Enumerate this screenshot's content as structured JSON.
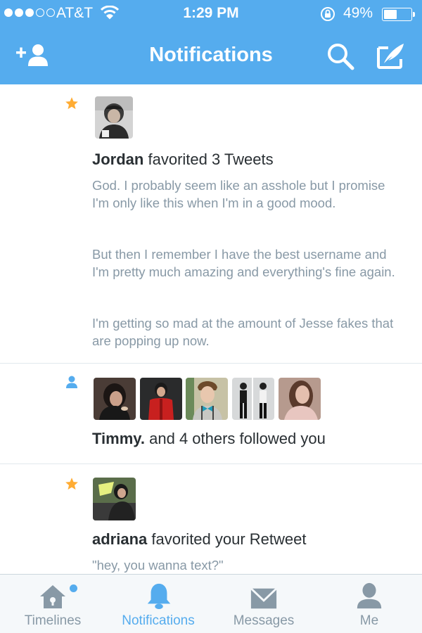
{
  "status": {
    "carrier": "AT&T",
    "time": "1:29 PM",
    "battery": "49%",
    "battery_level": 0.49
  },
  "nav": {
    "title": "Notifications"
  },
  "notifications": [
    {
      "type": "favorite",
      "user": "Jordan",
      "action": "favorited 3 Tweets",
      "tweets": [
        "God. I probably seem like an asshole but I promise I'm only like this when I'm in a good mood.",
        "But then I remember I have the best username and I'm pretty much amazing and everything's fine again.",
        "I'm getting so mad at the amount of Jesse fakes that are popping up now."
      ]
    },
    {
      "type": "follow",
      "user": "Timmy.",
      "action": "and 4 others followed you"
    },
    {
      "type": "favorite",
      "user": "adriana",
      "action": "favorited your Retweet",
      "tweets": [
        "\"hey, you wanna text?\""
      ]
    }
  ],
  "tabs": [
    {
      "label": "Timelines",
      "icon": "home-icon",
      "active": false,
      "unread_dot": true
    },
    {
      "label": "Notifications",
      "icon": "bell-icon",
      "active": true
    },
    {
      "label": "Messages",
      "icon": "envelope-icon",
      "active": false
    },
    {
      "label": "Me",
      "icon": "person-icon",
      "active": false
    }
  ],
  "colors": {
    "brand": "#55acee",
    "star": "#ffac33",
    "muted": "#8899a6",
    "text": "#292f33"
  }
}
